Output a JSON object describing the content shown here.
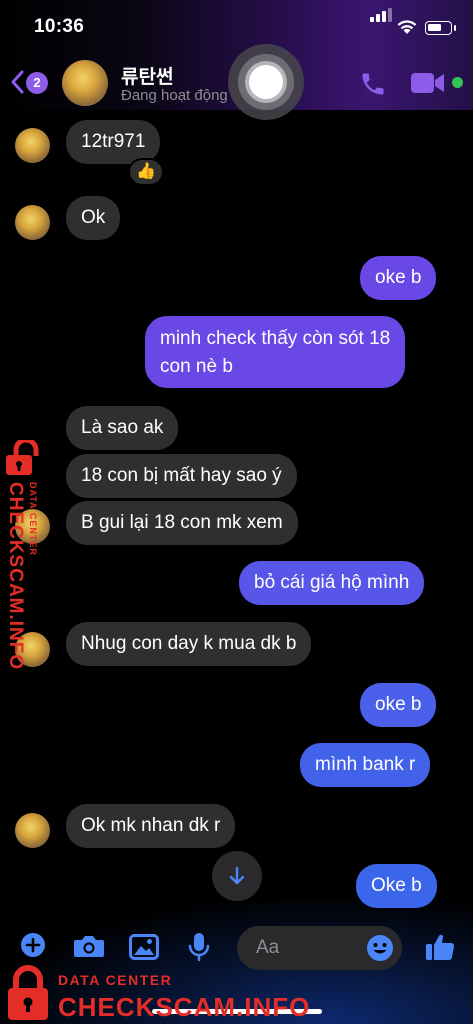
{
  "status_bar": {
    "time": "10:36"
  },
  "header": {
    "back_count": "2",
    "contact_name": "류탄썬",
    "contact_status": "Đang hoạt động"
  },
  "messages": [
    {
      "side": "in",
      "text": "12tr971"
    },
    {
      "side": "in",
      "text": "Ok"
    },
    {
      "side": "out",
      "text": "oke b"
    },
    {
      "side": "out",
      "text": "minh check thấy còn sót 18",
      "text2": "con nè b"
    },
    {
      "side": "in",
      "text": "Là sao ak"
    },
    {
      "side": "in",
      "text": "18 con bị mất hay sao ý"
    },
    {
      "side": "in",
      "text": "B gui lại 18 con mk xem"
    },
    {
      "side": "out",
      "text": "bỏ cái giá hộ mình"
    },
    {
      "side": "in",
      "text": "Nhug con day k mua dk b"
    },
    {
      "side": "out",
      "text": "oke b"
    },
    {
      "side": "out",
      "text": "mình bank r"
    },
    {
      "side": "in",
      "text": "Ok mk nhan dk r"
    },
    {
      "side": "out",
      "text": "Oke b"
    }
  ],
  "reaction": "👍",
  "composer": {
    "placeholder": "Aa"
  },
  "watermark": {
    "label_small": "DATA CENTER",
    "label_large": "CHECKSCAM.INFO"
  },
  "colors": {
    "accent": "#8d5ce8",
    "outgoing_top": "#6a48e6",
    "outgoing_bottom": "#3b66ea",
    "incoming": "#2f2f2f",
    "online": "#31c453",
    "composer_icons": "#4a86f7",
    "watermark": "#e52d27"
  }
}
